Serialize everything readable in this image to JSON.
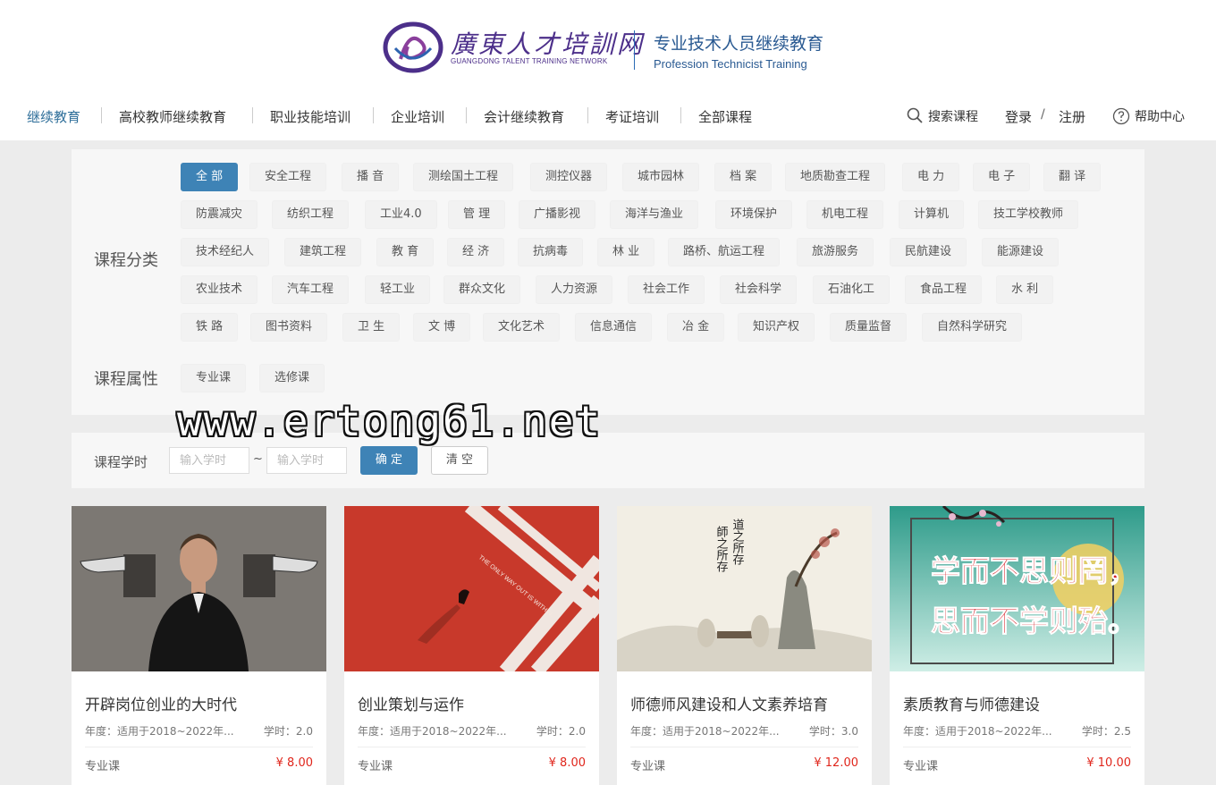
{
  "logo": {
    "cn": "廣東人才培訓网",
    "en": "GUANGDONG TALENT TRAINING NETWORK",
    "slogan": "专业技术人员继续教育",
    "slogan_en": "Profession Technicist Training"
  },
  "nav": {
    "items": [
      {
        "label": "继续教育",
        "active": true
      },
      {
        "label": "高校教师继续教育"
      },
      {
        "label": "职业技能培训"
      },
      {
        "label": "企业培训"
      },
      {
        "label": "会计继续教育"
      },
      {
        "label": "考证培训"
      },
      {
        "label": "全部课程"
      }
    ],
    "search": "搜索课程",
    "login": "登录",
    "slash": "/",
    "register": "注册",
    "help": "帮助中心"
  },
  "filters": {
    "category_label": "课程分类",
    "categories": [
      [
        "全 部",
        "安全工程",
        "播 音",
        "测绘国土工程",
        "测控仪器",
        "城市园林",
        "档 案",
        "地质勘查工程",
        "电 力",
        "电 子",
        "翻 译"
      ],
      [
        "防震减灾",
        "纺织工程",
        "工业4.0",
        "管 理",
        "广播影视",
        "海洋与渔业",
        "环境保护",
        "机电工程",
        "计算机",
        "技工学校教师"
      ],
      [
        "技术经纪人",
        "建筑工程",
        "教 育",
        "经 济",
        "抗病毒",
        "林 业",
        "路桥、航运工程",
        "旅游服务",
        "民航建设",
        "能源建设"
      ],
      [
        "农业技术",
        "汽车工程",
        "轻工业",
        "群众文化",
        "人力资源",
        "社会工作",
        "社会科学",
        "石油化工",
        "食品工程",
        "水 利"
      ],
      [
        "铁 路",
        "图书资料",
        "卫 生",
        "文 博",
        "文化艺术",
        "信息通信",
        "冶 金",
        "知识产权",
        "质量监督",
        "自然科学研究"
      ]
    ],
    "attr_label": "课程属性",
    "attrs": [
      "专业课",
      "选修课"
    ]
  },
  "hours": {
    "label": "课程学时",
    "placeholder_min": "输入学时",
    "placeholder_max": "输入学时",
    "tilde": "~",
    "confirm": "确 定",
    "clear": "清 空"
  },
  "watermark": "www.ertong61.net",
  "courses": [
    {
      "title": "开辟岗位创业的大时代",
      "year": "年度：适用于2018~2022年...",
      "hours": "学时：2.0",
      "type": "专业课",
      "price": "¥ 8.00"
    },
    {
      "title": "创业策划与运作",
      "year": "年度：适用于2018~2022年...",
      "hours": "学时：2.0",
      "type": "专业课",
      "price": "¥ 8.00",
      "img_text": "THE ONLY WAY OUT IS WITHIN."
    },
    {
      "title": "师德师风建设和人文素养培育",
      "year": "年度：适用于2018~2022年...",
      "hours": "学时：3.0",
      "type": "专业课",
      "price": "¥ 12.00",
      "img_text1": "道之所存",
      "img_text2": "師之所存"
    },
    {
      "title": "素质教育与师德建设",
      "year": "年度：适用于2018~2022年...",
      "hours": "学时：2.5",
      "type": "专业课",
      "price": "¥ 10.00",
      "img_text1": "学而不思则罔，",
      "img_text2": "思而不学则殆。"
    }
  ],
  "colors": {
    "accent": "#3e83b6",
    "price": "#e0261c",
    "brand": "#4c2f8a"
  }
}
